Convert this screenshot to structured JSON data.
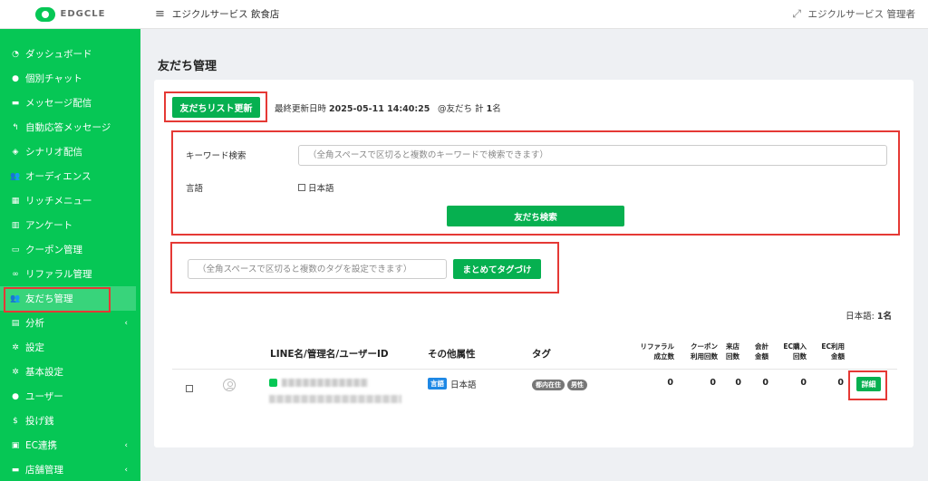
{
  "app": {
    "logo_text": "EDGCLE",
    "store_name": "エジクルサービス 飲食店",
    "user_name": "エジクルサービス 管理者"
  },
  "sidebar": {
    "items": [
      {
        "label": "ダッシュボード",
        "icon": "dashboard-icon",
        "glyph": "◔"
      },
      {
        "label": "個別チャット",
        "icon": "chat-bubble-icon",
        "glyph": "●"
      },
      {
        "label": "メッセージ配信",
        "icon": "message-icon",
        "glyph": "▬"
      },
      {
        "label": "自動応答メッセージ",
        "icon": "reply-icon",
        "glyph": "↰"
      },
      {
        "label": "シナリオ配信",
        "icon": "layers-icon",
        "glyph": "◈"
      },
      {
        "label": "オーディエンス",
        "icon": "users-icon",
        "glyph": "👥"
      },
      {
        "label": "リッチメニュー",
        "icon": "grid-icon",
        "glyph": "▦"
      },
      {
        "label": "アンケート",
        "icon": "poll-icon",
        "glyph": "▥"
      },
      {
        "label": "クーポン管理",
        "icon": "coupon-icon",
        "glyph": "▭"
      },
      {
        "label": "リファラル管理",
        "icon": "link-icon",
        "glyph": "∞"
      },
      {
        "label": "友だち管理",
        "icon": "friends-icon",
        "glyph": "👥",
        "active": true
      },
      {
        "label": "分析",
        "icon": "chart-icon",
        "glyph": "▤",
        "arrow": "‹"
      },
      {
        "label": "設定",
        "icon": "gear-icon",
        "glyph": "✲"
      },
      {
        "label": "基本設定",
        "icon": "gear-icon",
        "glyph": "✲"
      },
      {
        "label": "ユーザー",
        "icon": "user-icon",
        "glyph": "●"
      },
      {
        "label": "投げ銭",
        "icon": "dollar-icon",
        "glyph": "$"
      },
      {
        "label": "EC連携",
        "icon": "shopping-bag-icon",
        "glyph": "▣",
        "arrow": "‹"
      },
      {
        "label": "店舗管理",
        "icon": "store-icon",
        "glyph": "▬",
        "arrow": "‹"
      }
    ]
  },
  "page": {
    "title": "友だち管理",
    "refresh_label": "友だちリスト更新",
    "last_update_label": "最終更新日時",
    "last_update_value": "2025-05-11 14:40:25",
    "friend_count_prefix": "@友だち 計",
    "friend_count_value": "1",
    "friend_count_suffix": "名"
  },
  "search": {
    "keyword_label": "キーワード検索",
    "keyword_placeholder": "（全角スペースで区切ると複数のキーワードで検索できます）",
    "language_label": "言語",
    "language_option": "日本語",
    "search_button": "友だち検索"
  },
  "tagging": {
    "placeholder": "（全角スペースで区切ると複数のタグを設定できます）",
    "button": "まとめてタグづけ"
  },
  "summary": {
    "label": "日本語:",
    "value": "1名"
  },
  "table": {
    "headers": {
      "name": "LINE名/管理名/ユーザーID",
      "attributes": "その他属性",
      "tags": "タグ",
      "referral_1": "リファラル",
      "referral_2": "成立数",
      "coupon_1": "クーポン",
      "coupon_2": "利用回数",
      "visit_1": "来店",
      "visit_2": "回数",
      "payment_1": "会計",
      "payment_2": "金額",
      "ec_buy_1": "EC購入",
      "ec_buy_2": "回数",
      "ec_use_1": "EC利用",
      "ec_use_2": "金額"
    },
    "rows": [
      {
        "lang_badge": "言語",
        "lang_value": "日本語",
        "tags": [
          "都内在住",
          "男性"
        ],
        "referral": "0",
        "coupon": "0",
        "visit": "0",
        "payment": "0",
        "ec_buy": "0",
        "ec_use": "0",
        "detail": "詳細"
      }
    ]
  }
}
